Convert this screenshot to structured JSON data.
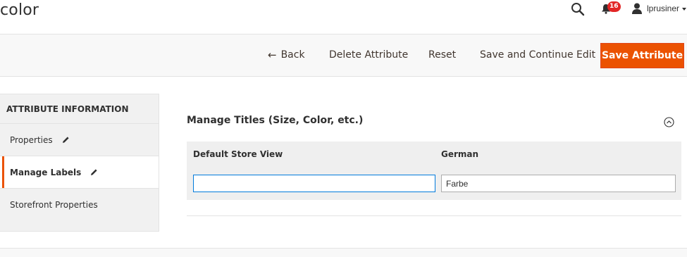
{
  "header": {
    "title": "color",
    "notifications_count": "16",
    "username": "lprusiner",
    "icons": {
      "search": "search-icon",
      "bell": "bell-icon",
      "user": "user-icon"
    }
  },
  "actions": {
    "back_label": "Back",
    "delete_label": "Delete Attribute",
    "reset_label": "Reset",
    "save_continue_label": "Save and Continue Edit",
    "save_label": "Save Attribute"
  },
  "sidebar": {
    "title": "ATTRIBUTE INFORMATION",
    "items": [
      {
        "label": "Properties",
        "active": false,
        "editable": true
      },
      {
        "label": "Manage Labels",
        "active": true,
        "editable": true
      },
      {
        "label": "Storefront Properties",
        "active": false,
        "editable": false
      }
    ]
  },
  "main": {
    "section_title": "Manage Titles (Size, Color, etc.)",
    "columns": [
      "Default Store View",
      "German"
    ],
    "values": {
      "default_store_view": "",
      "german": "Farbe"
    }
  },
  "colors": {
    "accent": "#eb5202",
    "badge": "#e22626",
    "focus_border": "#007bdb"
  }
}
